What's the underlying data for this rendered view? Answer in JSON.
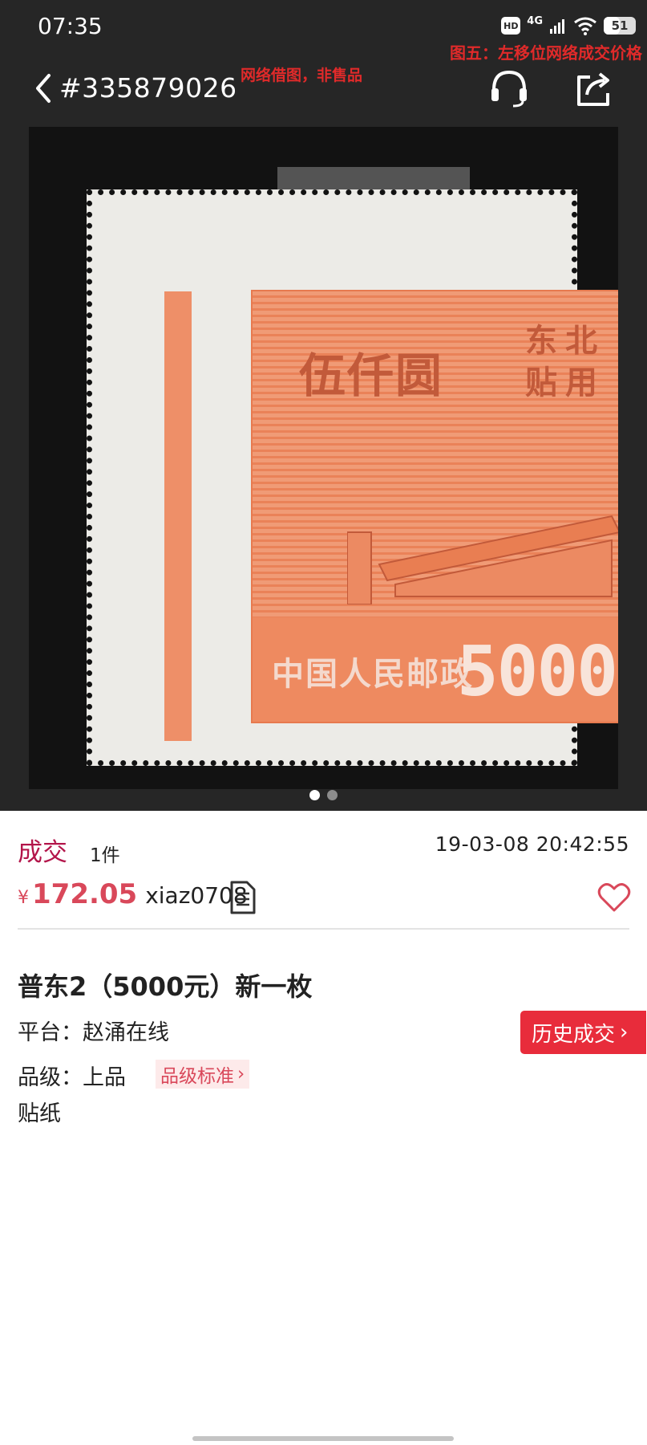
{
  "status_bar": {
    "time": "07:35",
    "hd_label": "HD",
    "network_label": "4G",
    "battery_level": 51,
    "battery_text": "51"
  },
  "nav": {
    "item_id": "#335879026",
    "notice_image": "网络借图，非售品",
    "notice_caption": "图五：左移位网络成交价格",
    "icons": [
      "back-arrow-icon",
      "headset-icon",
      "share-icon"
    ]
  },
  "gallery": {
    "stamp": {
      "denomination_cn": "伍仟圆",
      "region_text": "东北 贴用",
      "country_text": "中国人民邮政",
      "value_text": "5000"
    },
    "page_count": 2,
    "current_page": 1
  },
  "deal": {
    "status": "成交",
    "quantity": "1件",
    "time": "19-03-08 20:42:55",
    "price_symbol": "¥",
    "price": "172.05",
    "seller": "xiaz0708"
  },
  "item": {
    "title": "普东2（5000元）新一枚",
    "platform": "平台：赵涌在线",
    "history_button": "历史成交",
    "grade": "品级：上品",
    "grade_standard": "品级标准",
    "note": "贴纸"
  },
  "colors": {
    "header_bg": "#262626",
    "accent_red": "#e82c3b",
    "status_red": "#b3154a",
    "price_red": "#d9485a",
    "notice_red": "#e02a2a",
    "stamp_orange": "#ee8a60"
  }
}
